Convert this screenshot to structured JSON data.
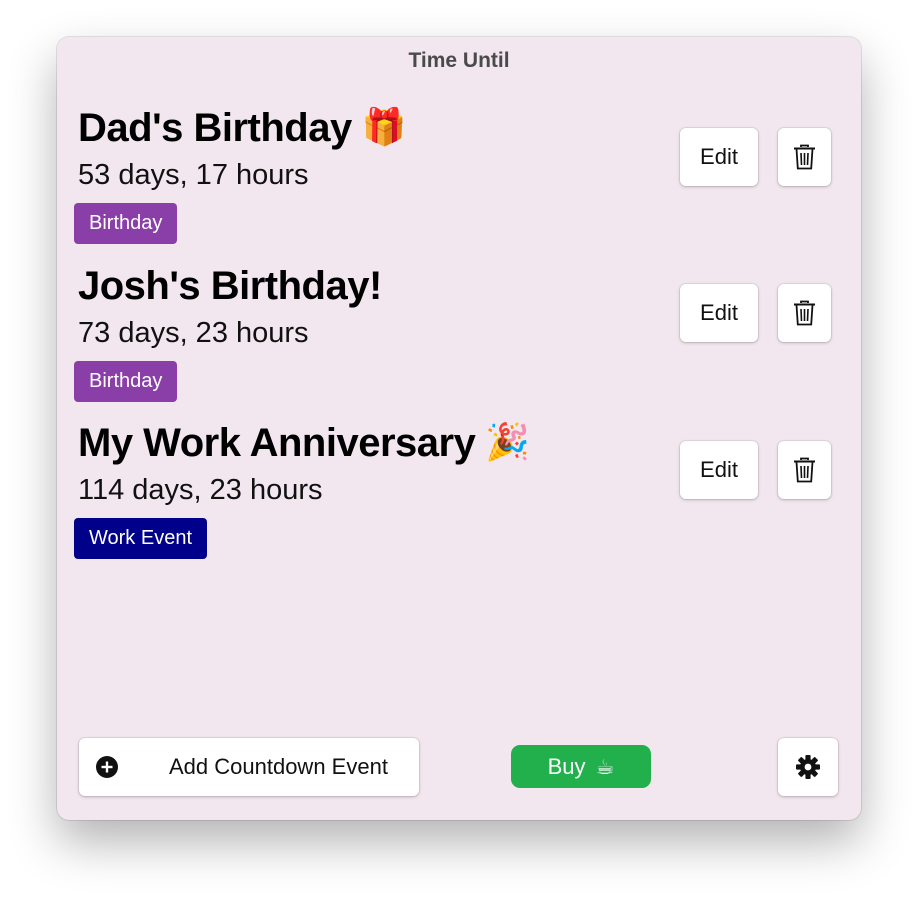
{
  "window": {
    "title": "Time Until"
  },
  "events": [
    {
      "title": "Dad's Birthday",
      "emoji": "🎁",
      "countdown": "53 days, 17 hours",
      "tag": "Birthday",
      "tag_color": "#8a3fa8",
      "edit_label": "Edit",
      "delete_icon": "trash-icon"
    },
    {
      "title": "Josh's Birthday!",
      "emoji": "",
      "countdown": "73 days, 23 hours",
      "tag": "Birthday",
      "tag_color": "#8a3fa8",
      "edit_label": "Edit",
      "delete_icon": "trash-icon"
    },
    {
      "title": "My Work Anniversary",
      "emoji": "🎉",
      "countdown": "114 days, 23 hours",
      "tag": "Work Event",
      "tag_color": "#00008b",
      "edit_label": "Edit",
      "delete_icon": "trash-icon"
    }
  ],
  "footer": {
    "add_label": "Add Countdown Event",
    "add_icon": "plus-circle-icon",
    "buy_label": "Buy",
    "buy_emoji": "☕",
    "buy_color": "#22b04c",
    "settings_icon": "gear-icon"
  },
  "colors": {
    "window_background": "#f2e7ee",
    "title_text": "#4a4a4a"
  }
}
